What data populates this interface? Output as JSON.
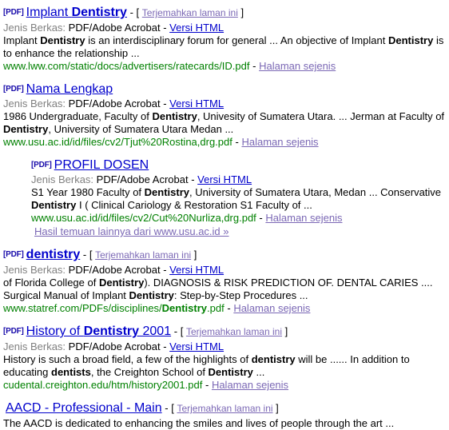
{
  "labels": {
    "pdf_tag": "[PDF]",
    "dash": "-",
    "bracket_open": "[",
    "bracket_close": "]",
    "filetype_label": "Jenis Berkas:",
    "filetype_value": "PDF/Adobe Acrobat",
    "html_version_link": "Versi HTML",
    "similar_link": "Halaman sejenis",
    "translate_link": "Terjemahkan laman ini",
    "separator": "-"
  },
  "colors": {
    "link_blue": "#0000cc",
    "visited_purple": "#7b68b5",
    "url_green": "#008000",
    "gray_label": "#808080",
    "body_black": "#000000",
    "pdf_tag_blue": "#1a0dab"
  },
  "results": [
    {
      "pdf": true,
      "indented": false,
      "has_translate": true,
      "title_parts": [
        {
          "text": "Implant ",
          "bold": false
        },
        {
          "text": "Dentistry",
          "bold": true
        }
      ],
      "snippet_parts": [
        {
          "text": "Implant ",
          "bold": false
        },
        {
          "text": "Dentistry",
          "bold": true
        },
        {
          "text": " is an interdisciplinary forum for general ... An objective of Implant ",
          "bold": false
        },
        {
          "text": "Dentistry",
          "bold": true
        },
        {
          "text": " is to enhance the relationship ...",
          "bold": false
        }
      ],
      "url_parts": [
        {
          "text": "www.lww.com/static/docs/advertisers/ratecards/ID.pdf",
          "bold": false
        }
      ]
    },
    {
      "pdf": true,
      "indented": false,
      "has_translate": false,
      "title_parts": [
        {
          "text": "Nama Lengkap",
          "bold": false
        }
      ],
      "snippet_parts": [
        {
          "text": "1986 Undergraduate, Faculty of ",
          "bold": false
        },
        {
          "text": "Dentistry",
          "bold": true
        },
        {
          "text": ", Univesity of Sumatera Utara. ... Jerman at Faculty of ",
          "bold": false
        },
        {
          "text": "Dentistry",
          "bold": true
        },
        {
          "text": ", University of Sumatera Utara Medan ...",
          "bold": false
        }
      ],
      "url_parts": [
        {
          "text": "www.usu.ac.id/id/files/cv2/Tjut%20Rostina,drg.pdf",
          "bold": false
        }
      ]
    },
    {
      "pdf": true,
      "indented": true,
      "has_translate": false,
      "title_parts": [
        {
          "text": "PROFIL DOSEN",
          "bold": false
        }
      ],
      "snippet_parts": [
        {
          "text": "S1 Year 1980 Faculty of ",
          "bold": false
        },
        {
          "text": "Dentistry",
          "bold": true
        },
        {
          "text": ", University of Sumatera Utara, Medan ... Conservative ",
          "bold": false
        },
        {
          "text": "Dentistry",
          "bold": true
        },
        {
          "text": " I ( Clinical Cariology & Restoration S1 Faculty of ...",
          "bold": false
        }
      ],
      "url_parts": [
        {
          "text": "www.usu.ac.id/id/files/cv2/Cut%20Nurliza,drg.pdf",
          "bold": false
        }
      ],
      "more_results": "Hasil temuan lainnya dari www.usu.ac.id »"
    },
    {
      "pdf": true,
      "indented": false,
      "has_translate": true,
      "title_all_bold": true,
      "title_parts": [
        {
          "text": "dentistry",
          "bold": true
        }
      ],
      "snippet_parts": [
        {
          "text": "of Florida College of ",
          "bold": false
        },
        {
          "text": "Dentistry",
          "bold": true
        },
        {
          "text": "). DIAGNOSIS & RISK PREDICTION OF. DENTAL CARIES .... Surgical Manual of Implant ",
          "bold": false
        },
        {
          "text": "Dentistry",
          "bold": true
        },
        {
          "text": ": Step-by-Step Procedures ...",
          "bold": false
        }
      ],
      "url_parts": [
        {
          "text": "www.statref.com/PDFs/disciplines/",
          "bold": false
        },
        {
          "text": "Dentistry",
          "bold": true
        },
        {
          "text": ".pdf",
          "bold": false
        }
      ]
    },
    {
      "pdf": true,
      "indented": false,
      "has_translate": true,
      "title_parts": [
        {
          "text": "History of ",
          "bold": false
        },
        {
          "text": "Dentistry",
          "bold": true
        },
        {
          "text": " 2001",
          "bold": false
        }
      ],
      "snippet_parts": [
        {
          "text": "History is such a broad field, a few of the highlights of ",
          "bold": false
        },
        {
          "text": "dentistry",
          "bold": true
        },
        {
          "text": " will be ...... In addition to educating ",
          "bold": false
        },
        {
          "text": "dentists",
          "bold": true
        },
        {
          "text": ", the Creighton School of ",
          "bold": false
        },
        {
          "text": "Dentistry",
          "bold": true
        },
        {
          "text": " ...",
          "bold": false
        }
      ],
      "url_parts": [
        {
          "text": "cudental.creighton.edu/htm/history2001.pdf",
          "bold": false
        }
      ]
    },
    {
      "pdf": false,
      "indented": false,
      "has_translate": true,
      "partial": true,
      "title_parts": [
        {
          "text": "AACD - Professional - Main",
          "bold": false
        }
      ],
      "snippet_parts": [
        {
          "text": "The AACD is dedicated to enhancing the smiles and lives of people through the art ...",
          "bold": false
        }
      ],
      "url_parts": []
    }
  ]
}
